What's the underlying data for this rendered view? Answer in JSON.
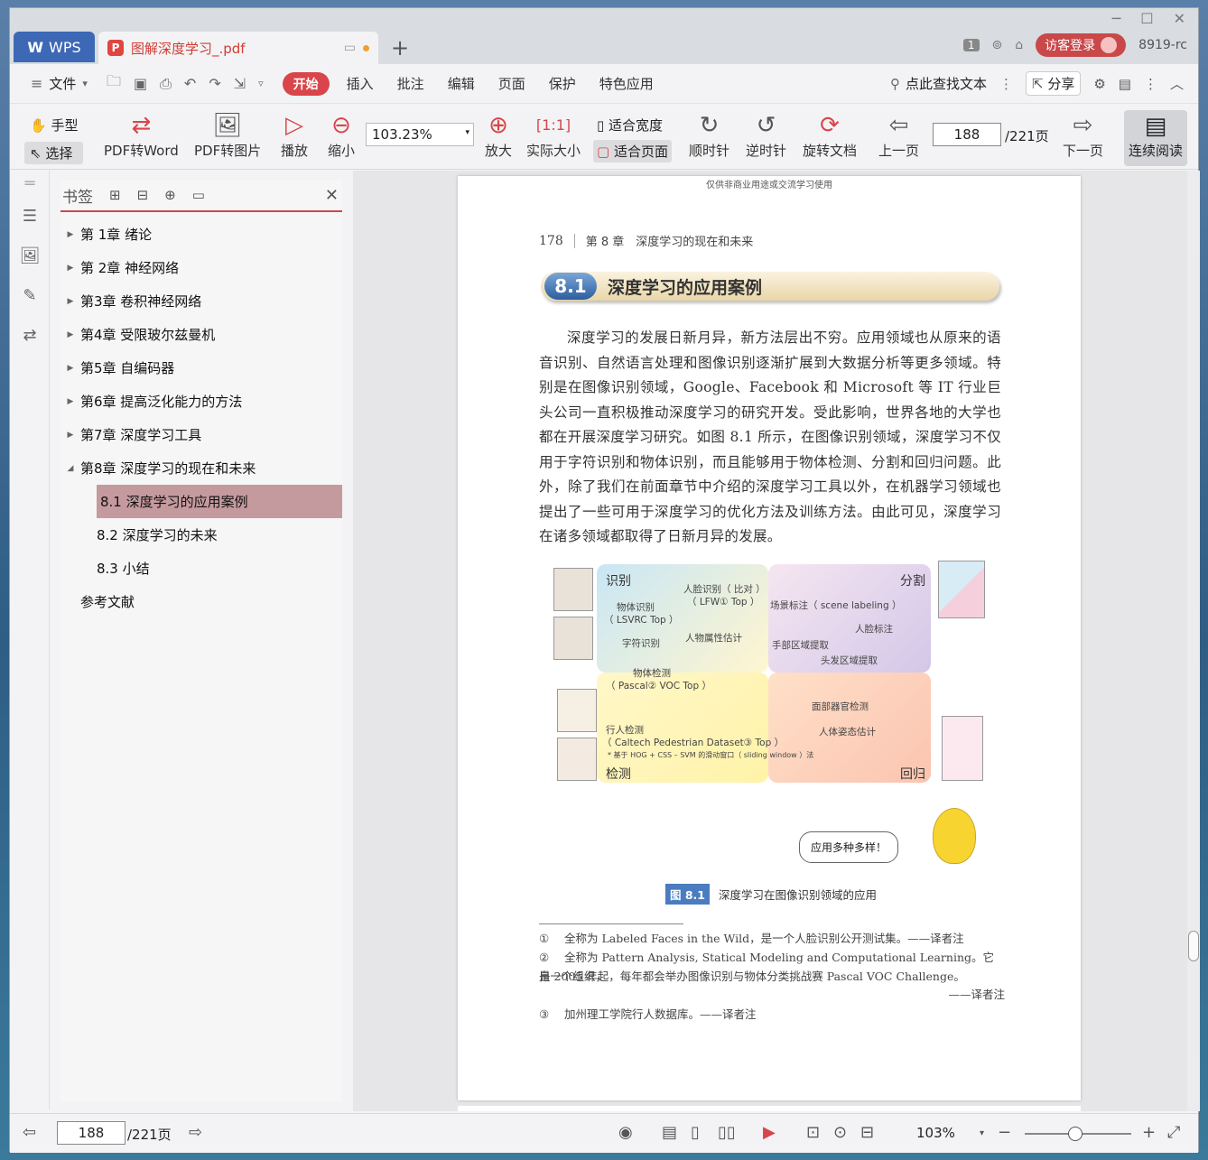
{
  "titlebar": {
    "app_tab": "WPS",
    "doc_tab": "图解深度学习_.pdf",
    "new_tab": "+",
    "badge": "1",
    "login": "访客登录",
    "user": "8919-rc"
  },
  "menubar": {
    "file": "文件",
    "tabs": [
      "开始",
      "插入",
      "批注",
      "编辑",
      "页面",
      "保护",
      "特色应用"
    ],
    "search": "点此查找文本",
    "share": "分享"
  },
  "toolbar": {
    "hand": "手型",
    "select": "选择",
    "pdf_word": "PDF转Word",
    "pdf_image": "PDF转图片",
    "play": "播放",
    "zoom_out": "缩小",
    "zoom_value": "103.23%",
    "zoom_in": "放大",
    "actual_size": "实际大小",
    "fit_width": "适合宽度",
    "fit_page": "适合页面",
    "clockwise": "顺时针",
    "counterclockwise": "逆时针",
    "rotate_doc": "旋转文档",
    "prev_page": "上一页",
    "page_value": "188",
    "page_total": "/221页",
    "next_page": "下一页",
    "continuous": "连续阅读"
  },
  "bookmarks": {
    "title": "书签",
    "items": [
      {
        "label": "第 1章 绪论"
      },
      {
        "label": "第 2章 神经网络"
      },
      {
        "label": "第3章 卷积神经网络"
      },
      {
        "label": "第4章 受限玻尔兹曼机"
      },
      {
        "label": "第5章 自编码器"
      },
      {
        "label": "第6章 提高泛化能力的方法"
      },
      {
        "label": "第7章 深度学习工具"
      },
      {
        "label": "第8章 深度学习的现在和未来"
      },
      {
        "label": "8.1 深度学习的应用案例"
      },
      {
        "label": "8.2 深度学习的未来"
      },
      {
        "label": "8.3 小结"
      },
      {
        "label": "参考文献"
      }
    ]
  },
  "page": {
    "watermark": "仅供非商业用途或交流学习使用",
    "page_number": "178",
    "chapter": "第 8 章　深度学习的现在和未来",
    "section_num": "8.1",
    "section_title": "深度学习的应用案例",
    "paragraph": "深度学习的发展日新月异，新方法层出不穷。应用领域也从原来的语音识别、自然语言处理和图像识别逐渐扩展到大数据分析等更多领域。特别是在图像识别领域，Google、Facebook 和 Microsoft 等 IT 行业巨头公司一直积极推动深度学习的研究开发。受此影响，世界各地的大学也都在开展深度学习研究。如图 8.1 所示，在图像识别领域，深度学习不仅用于字符识别和物体识别，而且能够用于物体检测、分割和回归问题。此外，除了我们在前面章节中介绍的深度学习工具以外，在机器学习领域也提出了一些可用于深度学习的优化方法及训练方法。由此可见，深度学习在诸多领域都取得了日新月异的发展。",
    "figure": {
      "recognition": "识别",
      "segmentation": "分割",
      "detection": "检测",
      "regression": "回归",
      "obj_recog": "物体识别",
      "lsvrc": "（ LSVRC Top ）",
      "face_recog": "人脸识别（ 比对 ）",
      "lfw": "（ LFW① Top ）",
      "scene": "场景标注（ scene labeling ）",
      "face_label": "人脸标注",
      "char_recog": "字符识别",
      "person_attr": "人物属性估计",
      "hand_region": "手部区域提取",
      "hair_region": "头发区域提取",
      "obj_detect": "物体检测",
      "pascal": "（ Pascal② VOC Top ）",
      "facial_organ": "面部器官检测",
      "pedestrian": "行人检测",
      "pose": "人体姿态估计",
      "caltech": "（ Caltech Pedestrian Dataset③ Top ）",
      "hog_note": "* 基于 HOG + CSS – SVM 的滑动窗口（ sliding window ）法",
      "bubble": "应用多种多样！"
    },
    "caption_tag": "图 8.1",
    "caption_text": "深度学习在图像识别领域的应用",
    "footnotes": [
      {
        "n": "①",
        "text": "全称为 Labeled Faces in the Wild，是一个人脸识别公开测试集。——译者注"
      },
      {
        "n": "②",
        "text": "全称为 Pattern Analysis, Statical Modeling and Computational Learning。它是一个组织，"
      },
      {
        "n": "",
        "text": "自 2005 年起，每年都会举办图像识别与物体分类挑战赛 Pascal VOC Challenge。"
      },
      {
        "n": "",
        "text": "——译者注"
      },
      {
        "n": "③",
        "text": "加州理工学院行人数据库。——译者注"
      }
    ]
  },
  "statusbar": {
    "page_value": "188",
    "page_total": "/221页",
    "zoom": "103%"
  },
  "colors": {
    "accent": "#d9454a",
    "wps_blue": "#3d68b5",
    "bookmark_active": "#c59a9e"
  }
}
